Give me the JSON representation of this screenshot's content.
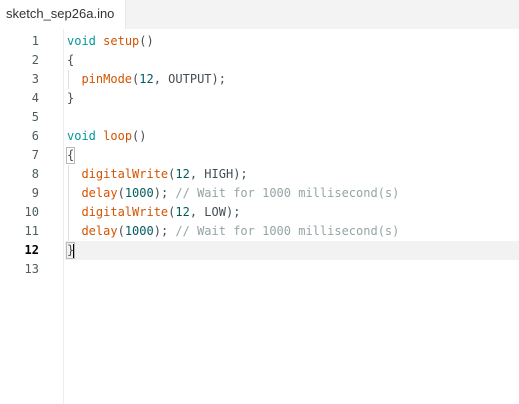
{
  "tab": {
    "filename": "sketch_sep26a.ino"
  },
  "editor": {
    "current_line": 12,
    "line_numbers": [
      "1",
      "2",
      "3",
      "4",
      "5",
      "6",
      "7",
      "8",
      "9",
      "10",
      "11",
      "12",
      "13"
    ],
    "lines": [
      {
        "indent": "",
        "tokens": [
          {
            "t": "kw",
            "v": "void"
          },
          {
            "t": "pn",
            "v": " "
          },
          {
            "t": "fn",
            "v": "setup"
          },
          {
            "t": "pn",
            "v": "()"
          }
        ]
      },
      {
        "indent": "",
        "tokens": [
          {
            "t": "pn",
            "v": "{"
          }
        ]
      },
      {
        "indent": "  ",
        "tokens": [
          {
            "t": "fn",
            "v": "pinMode"
          },
          {
            "t": "pn",
            "v": "("
          },
          {
            "t": "num",
            "v": "12"
          },
          {
            "t": "pn",
            "v": ", OUTPUT);"
          }
        ]
      },
      {
        "indent": "",
        "tokens": [
          {
            "t": "pn",
            "v": "}"
          }
        ]
      },
      {
        "indent": "",
        "tokens": []
      },
      {
        "indent": "",
        "tokens": [
          {
            "t": "kw",
            "v": "void"
          },
          {
            "t": "pn",
            "v": " "
          },
          {
            "t": "fn",
            "v": "loop"
          },
          {
            "t": "pn",
            "v": "()"
          }
        ]
      },
      {
        "indent": "",
        "tokens": [
          {
            "t": "pn",
            "v": "{",
            "match": true
          }
        ]
      },
      {
        "indent": "  ",
        "tokens": [
          {
            "t": "fn",
            "v": "digitalWrite"
          },
          {
            "t": "pn",
            "v": "("
          },
          {
            "t": "num",
            "v": "12"
          },
          {
            "t": "pn",
            "v": ", HIGH);"
          }
        ]
      },
      {
        "indent": "  ",
        "tokens": [
          {
            "t": "fn",
            "v": "delay"
          },
          {
            "t": "pn",
            "v": "("
          },
          {
            "t": "num",
            "v": "1000"
          },
          {
            "t": "pn",
            "v": "); "
          },
          {
            "t": "cm",
            "v": "// Wait for 1000 millisecond(s)"
          }
        ]
      },
      {
        "indent": "  ",
        "tokens": [
          {
            "t": "fn",
            "v": "digitalWrite"
          },
          {
            "t": "pn",
            "v": "("
          },
          {
            "t": "num",
            "v": "12"
          },
          {
            "t": "pn",
            "v": ", LOW);"
          }
        ]
      },
      {
        "indent": "  ",
        "tokens": [
          {
            "t": "fn",
            "v": "delay"
          },
          {
            "t": "pn",
            "v": "("
          },
          {
            "t": "num",
            "v": "1000"
          },
          {
            "t": "pn",
            "v": "); "
          },
          {
            "t": "cm",
            "v": "// Wait for 1000 millisecond(s)"
          }
        ]
      },
      {
        "indent": "",
        "tokens": [
          {
            "t": "pn",
            "v": "}",
            "match": true,
            "caret": true
          }
        ]
      },
      {
        "indent": "",
        "tokens": []
      }
    ]
  },
  "colors": {
    "keyword": "#00979c",
    "function": "#d35400",
    "number": "#005c5f",
    "comment": "#95a5a6",
    "text": "#434f54"
  }
}
